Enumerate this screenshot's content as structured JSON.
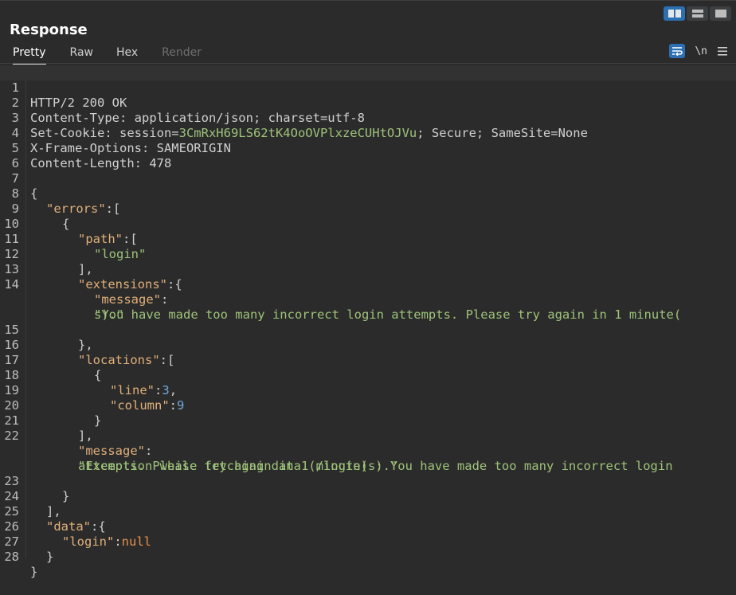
{
  "panel": {
    "title": "Response",
    "tabs": [
      {
        "label": "Pretty",
        "active": true,
        "enabled": true
      },
      {
        "label": "Raw",
        "active": false,
        "enabled": true
      },
      {
        "label": "Hex",
        "active": false,
        "enabled": true
      },
      {
        "label": "Render",
        "active": false,
        "enabled": false
      }
    ],
    "layout_buttons": [
      "split-horizontal-icon",
      "split-vertical-icon",
      "single-pane-icon"
    ],
    "toolbar": {
      "wrap_icon": "wrap-lines-icon",
      "newline_label": "\\n",
      "menu_icon": "hamburger-menu-icon"
    }
  },
  "colors": {
    "accent": "#2c6fb3",
    "json_key": "#e0b07a",
    "json_string": "#9ec37a",
    "json_number": "#6fa8dc",
    "json_null": "#e4904f",
    "background": "#2b2b2b"
  },
  "response": {
    "line_numbers": [
      "1",
      "2",
      "3",
      "4",
      "5",
      "6",
      "7",
      "8",
      "9",
      "10",
      "11",
      "12",
      "13",
      "14",
      "",
      "15",
      "16",
      "17",
      "18",
      "19",
      "20",
      "21",
      "22",
      "",
      "23",
      "24",
      "25",
      "26",
      "27",
      "28"
    ],
    "headers": {
      "status": "HTTP/2 200 OK",
      "content_type_name": "Content-Type: ",
      "content_type_value": "application/json; charset=utf-8",
      "set_cookie_name": "Set-Cookie: ",
      "cookie_key": "session=",
      "cookie_value": "3CmRxH69LS62tK4OoOVPlxzeCUHtOJVu",
      "cookie_rest": "; Secure; SameSite=None",
      "xfo_name": "X-Frame-Options: ",
      "xfo_value": "SAMEORIGIN",
      "cl_name": "Content-Length: ",
      "cl_value": "478"
    },
    "body": {
      "open_brace": "{",
      "errors_key": "\"errors\"",
      "colon_bracket": ":[",
      "colon_brace": ":{",
      "colon": ":",
      "obj_open": "{",
      "path_key": "\"path\"",
      "login_value": "\"login\"",
      "array_close_comma": "],",
      "extensions_key": "\"extensions\"",
      "message_key": "\"message\"",
      "message_line1": "\"You have made too many incorrect login attempts. Please try again in 1 minute(",
      "message_line2": "s).\"",
      "obj_close_comma": "},",
      "locations_key": "\"locations\"",
      "line_key": "\"line\"",
      "line_value": "3",
      "column_key": "\"column\"",
      "column_value": "9",
      "comma": ",",
      "obj_close": "}",
      "error_message_line1": "\"Exception while fetching data (/login) : You have made too many incorrect login",
      "error_message_line2": "attempts. Please try again in 1 minute(s).\"",
      "data_key": "\"data\"",
      "login_key": "\"login\"",
      "null_value": "null",
      "close_brace": "}"
    }
  }
}
